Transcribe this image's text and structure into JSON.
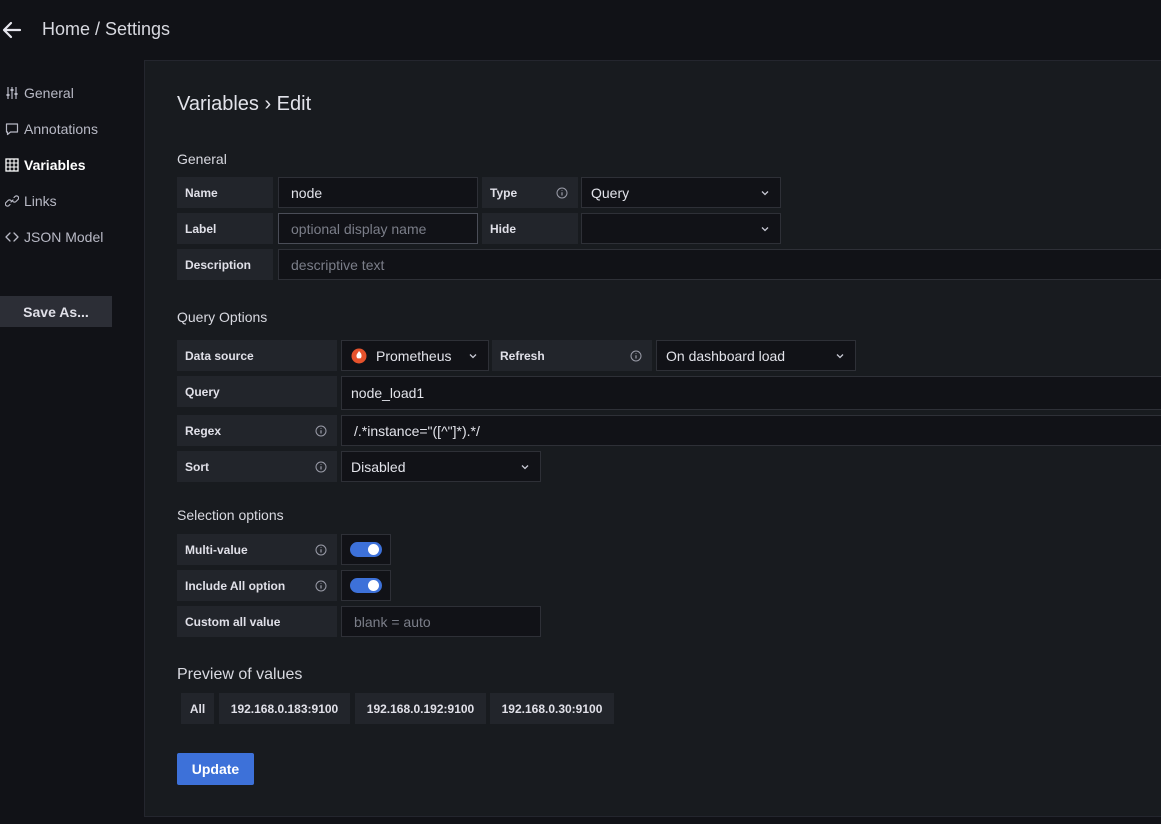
{
  "header": {
    "breadcrumb": "Home / Settings"
  },
  "sidebar": {
    "items": [
      {
        "label": "General"
      },
      {
        "label": "Annotations"
      },
      {
        "label": "Variables"
      },
      {
        "label": "Links"
      },
      {
        "label": "JSON Model"
      }
    ],
    "save_as_label": "Save As..."
  },
  "main": {
    "title": "Variables › Edit",
    "general": {
      "heading": "General",
      "name_label": "Name",
      "name_value": "node",
      "type_label": "Type",
      "type_value": "Query",
      "label_label": "Label",
      "label_placeholder": "optional display name",
      "hide_label": "Hide",
      "hide_value": "",
      "description_label": "Description",
      "description_placeholder": "descriptive text"
    },
    "query_options": {
      "heading": "Query Options",
      "datasource_label": "Data source",
      "datasource_value": "Prometheus",
      "refresh_label": "Refresh",
      "refresh_value": "On dashboard load",
      "query_label": "Query",
      "query_value": "node_load1",
      "regex_label": "Regex",
      "regex_value": "/.*instance=\"([^\"]*).*/",
      "sort_label": "Sort",
      "sort_value": "Disabled"
    },
    "selection_options": {
      "heading": "Selection options",
      "multi_label": "Multi-value",
      "multi_on": true,
      "include_all_label": "Include All option",
      "include_all_on": true,
      "custom_all_label": "Custom all value",
      "custom_all_placeholder": "blank = auto"
    },
    "preview": {
      "heading": "Preview of values",
      "values": [
        "All",
        "192.168.0.183:9100",
        "192.168.0.192:9100",
        "192.168.0.30:9100"
      ]
    },
    "update_label": "Update"
  },
  "colors": {
    "accent": "#3d71d9",
    "prometheus": "#e6522c"
  }
}
